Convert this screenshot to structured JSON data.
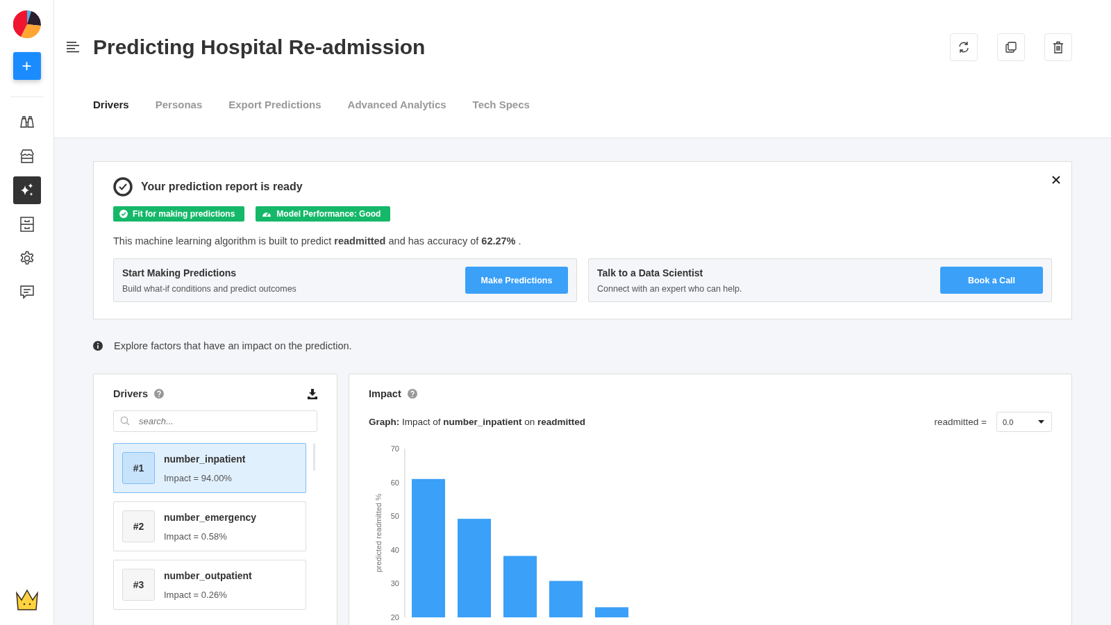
{
  "sidebar": {
    "new_button": "+",
    "items": [
      {
        "kind": "binoculars",
        "selected": false
      },
      {
        "kind": "store",
        "selected": false
      },
      {
        "kind": "sparkles",
        "selected": true
      },
      {
        "kind": "cabinet",
        "selected": false
      },
      {
        "kind": "settings",
        "selected": false
      },
      {
        "kind": "chat",
        "selected": false
      }
    ]
  },
  "header": {
    "title": "Predicting Hospital Re-admission",
    "actions": [
      {
        "kind": "refresh"
      },
      {
        "kind": "copy"
      },
      {
        "kind": "delete"
      }
    ]
  },
  "tabs": [
    {
      "label": "Drivers",
      "selected": true
    },
    {
      "label": "Personas",
      "selected": false
    },
    {
      "label": "Export Predictions",
      "selected": false
    },
    {
      "label": "Advanced Analytics",
      "selected": false
    },
    {
      "label": "Tech Specs",
      "selected": false
    }
  ],
  "report": {
    "title": "Your prediction report is ready",
    "badges": [
      {
        "kind": "check",
        "label": "Fit for making predictions"
      },
      {
        "kind": "gauge",
        "label": "Model Performance: Good"
      }
    ],
    "summary": "This machine learning algorithm is built to predict **readmitted** and has accuracy of **62.27%** .",
    "actions": [
      {
        "title": "Start Making Predictions",
        "subtitle": "Build what-if conditions and predict outcomes",
        "button": "Make Predictions"
      },
      {
        "title": "Talk to a Data Scientist",
        "subtitle": "Connect with an expert who can help.",
        "button": "Book a Call"
      }
    ]
  },
  "info": "Explore factors that have an impact on the prediction.",
  "drivers": {
    "title": "Drivers",
    "search": {
      "placeholder": "search..."
    },
    "items": [
      {
        "rank": "#1",
        "name": "number_inpatient",
        "impact": "Impact = 94.00%",
        "selected": true
      },
      {
        "rank": "#2",
        "name": "number_emergency",
        "impact": "Impact = 0.58%",
        "selected": false
      },
      {
        "rank": "#3",
        "name": "number_outpatient",
        "impact": "Impact = 0.26%",
        "selected": false
      }
    ]
  },
  "impact": {
    "title": "Impact",
    "caption": "**Graph:** Impact of **number_inpatient** on **readmitted**",
    "filter_label": "readmitted =",
    "filter_value": "0.0",
    "chart_data": {
      "type": "bar",
      "ylabel": "predicted readmitted %",
      "ylim": [
        20,
        70
      ],
      "yticks": [
        20,
        30,
        40,
        50,
        60,
        70
      ],
      "series": [
        {
          "color": "#3aa0f8",
          "values": [
            61,
            49.2,
            38.2,
            30.8,
            23
          ]
        }
      ]
    }
  }
}
